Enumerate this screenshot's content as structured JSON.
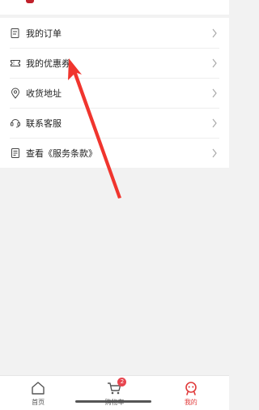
{
  "menu": {
    "items": [
      {
        "label": "我的订单",
        "icon": "order-list-icon"
      },
      {
        "label": "我的优惠券",
        "icon": "coupon-icon"
      },
      {
        "label": "收货地址",
        "icon": "location-pin-icon"
      },
      {
        "label": "联系客服",
        "icon": "customer-service-icon"
      },
      {
        "label": "查看《服务条款》",
        "icon": "document-icon"
      }
    ]
  },
  "tabbar": {
    "tabs": [
      {
        "label": "首页",
        "icon": "home-icon"
      },
      {
        "label": "购物车",
        "icon": "cart-icon",
        "badge": "2"
      },
      {
        "label": "我的",
        "icon": "profile-icon",
        "active": true
      }
    ]
  },
  "colors": {
    "accent": "#e03a3a",
    "badge": "#e8454f",
    "annotation_arrow": "#f0352e"
  }
}
